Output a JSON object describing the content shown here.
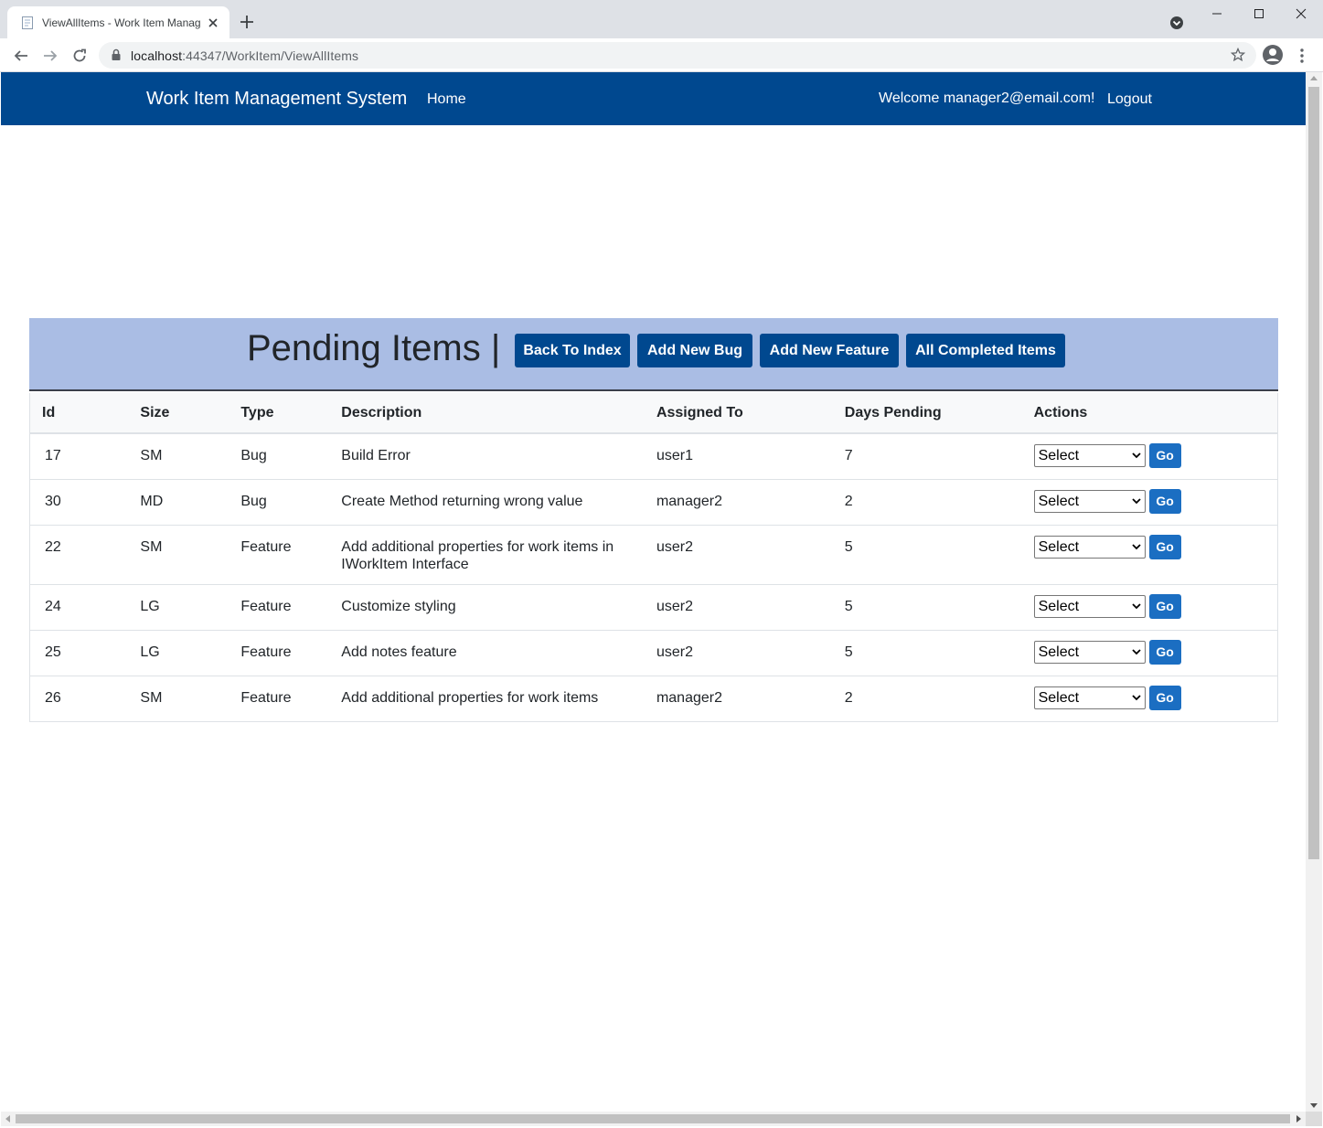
{
  "browser": {
    "tab_title": "ViewAllItems - Work Item Manag",
    "url_host": "localhost",
    "url_path": ":44347/WorkItem/ViewAllItems"
  },
  "navbar": {
    "brand": "Work Item Management System",
    "home": "Home",
    "welcome": "Welcome manager2@email.com!",
    "logout": "Logout"
  },
  "header": {
    "title": "Pending Items |",
    "buttons": [
      "Back To Index",
      "Add New Bug",
      "Add New Feature",
      "All Completed Items"
    ]
  },
  "table": {
    "columns": [
      "Id",
      "Size",
      "Type",
      "Description",
      "Assigned To",
      "Days Pending",
      "Actions"
    ],
    "rows": [
      {
        "id": "17",
        "size": "SM",
        "type": "Bug",
        "description": "Build Error",
        "assigned": "user1",
        "days": "7"
      },
      {
        "id": "30",
        "size": "MD",
        "type": "Bug",
        "description": "Create Method returning wrong value",
        "assigned": "manager2",
        "days": "2"
      },
      {
        "id": "22",
        "size": "SM",
        "type": "Feature",
        "description": "Add additional properties for work items in IWorkItem Interface",
        "assigned": "user2",
        "days": "5"
      },
      {
        "id": "24",
        "size": "LG",
        "type": "Feature",
        "description": "Customize styling",
        "assigned": "user2",
        "days": "5"
      },
      {
        "id": "25",
        "size": "LG",
        "type": "Feature",
        "description": "Add notes feature",
        "assigned": "user2",
        "days": "5"
      },
      {
        "id": "26",
        "size": "SM",
        "type": "Feature",
        "description": "Add additional properties for work items",
        "assigned": "manager2",
        "days": "2"
      }
    ],
    "select_label": "Select",
    "go_label": "Go"
  },
  "colors": {
    "navbar": "#00488f",
    "band": "#aabde4",
    "go_button": "#1b6ec2"
  }
}
